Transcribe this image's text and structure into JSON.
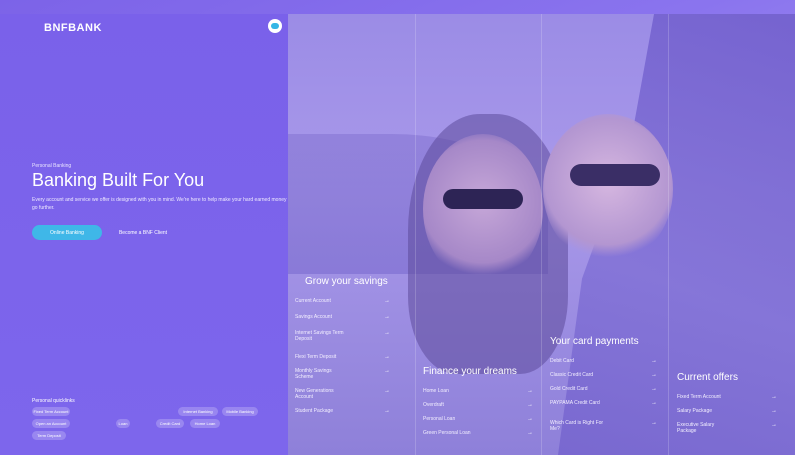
{
  "brand": {
    "name": "BNFBANK"
  },
  "hero": {
    "subtitle": "Personal Banking",
    "title": "Banking Built For You",
    "description": "Every account and service we offer is designed with you in mind. We're here to help make your hard earned money go further.",
    "primary_button": "Online Banking",
    "secondary_button": "Become a BNF Client"
  },
  "quicklinks": {
    "title": "Personal quicklinks",
    "items": [
      "Fixed Term Account",
      "Internet Banking",
      "Mobile Banking",
      "Open an Account",
      "Loan",
      "Credit Card",
      "Home Loan",
      "Term Deposit"
    ]
  },
  "savings": {
    "title": "Grow your savings",
    "items": [
      "Current Account",
      "Savings Account",
      "Internet Savings Term Deposit",
      "Flexi Term Deposit",
      "Monthly Savings Scheme",
      "New Generations Account",
      "Student Package"
    ]
  },
  "dreams": {
    "title": "Finance your dreams",
    "items": [
      "Home Loan",
      "Overdraft",
      "Personal Loan",
      "Green Personal Loan"
    ]
  },
  "cards": {
    "title": "Your card payments",
    "items": [
      "Debit Card",
      "Classic Credit Card",
      "Gold Credit Card",
      "PAYPAMA Credit Card",
      "Which Card is Right For Me?"
    ]
  },
  "offers": {
    "title": "Current offers",
    "items": [
      "Fixed Term Account",
      "Salary Package",
      "Executive Salary Package"
    ]
  },
  "icons": {
    "chat": "chat-icon",
    "arrow": "arrow-right-icon"
  },
  "colors": {
    "panel": "#7a61ea",
    "accent_button": "#3fb7e8"
  }
}
